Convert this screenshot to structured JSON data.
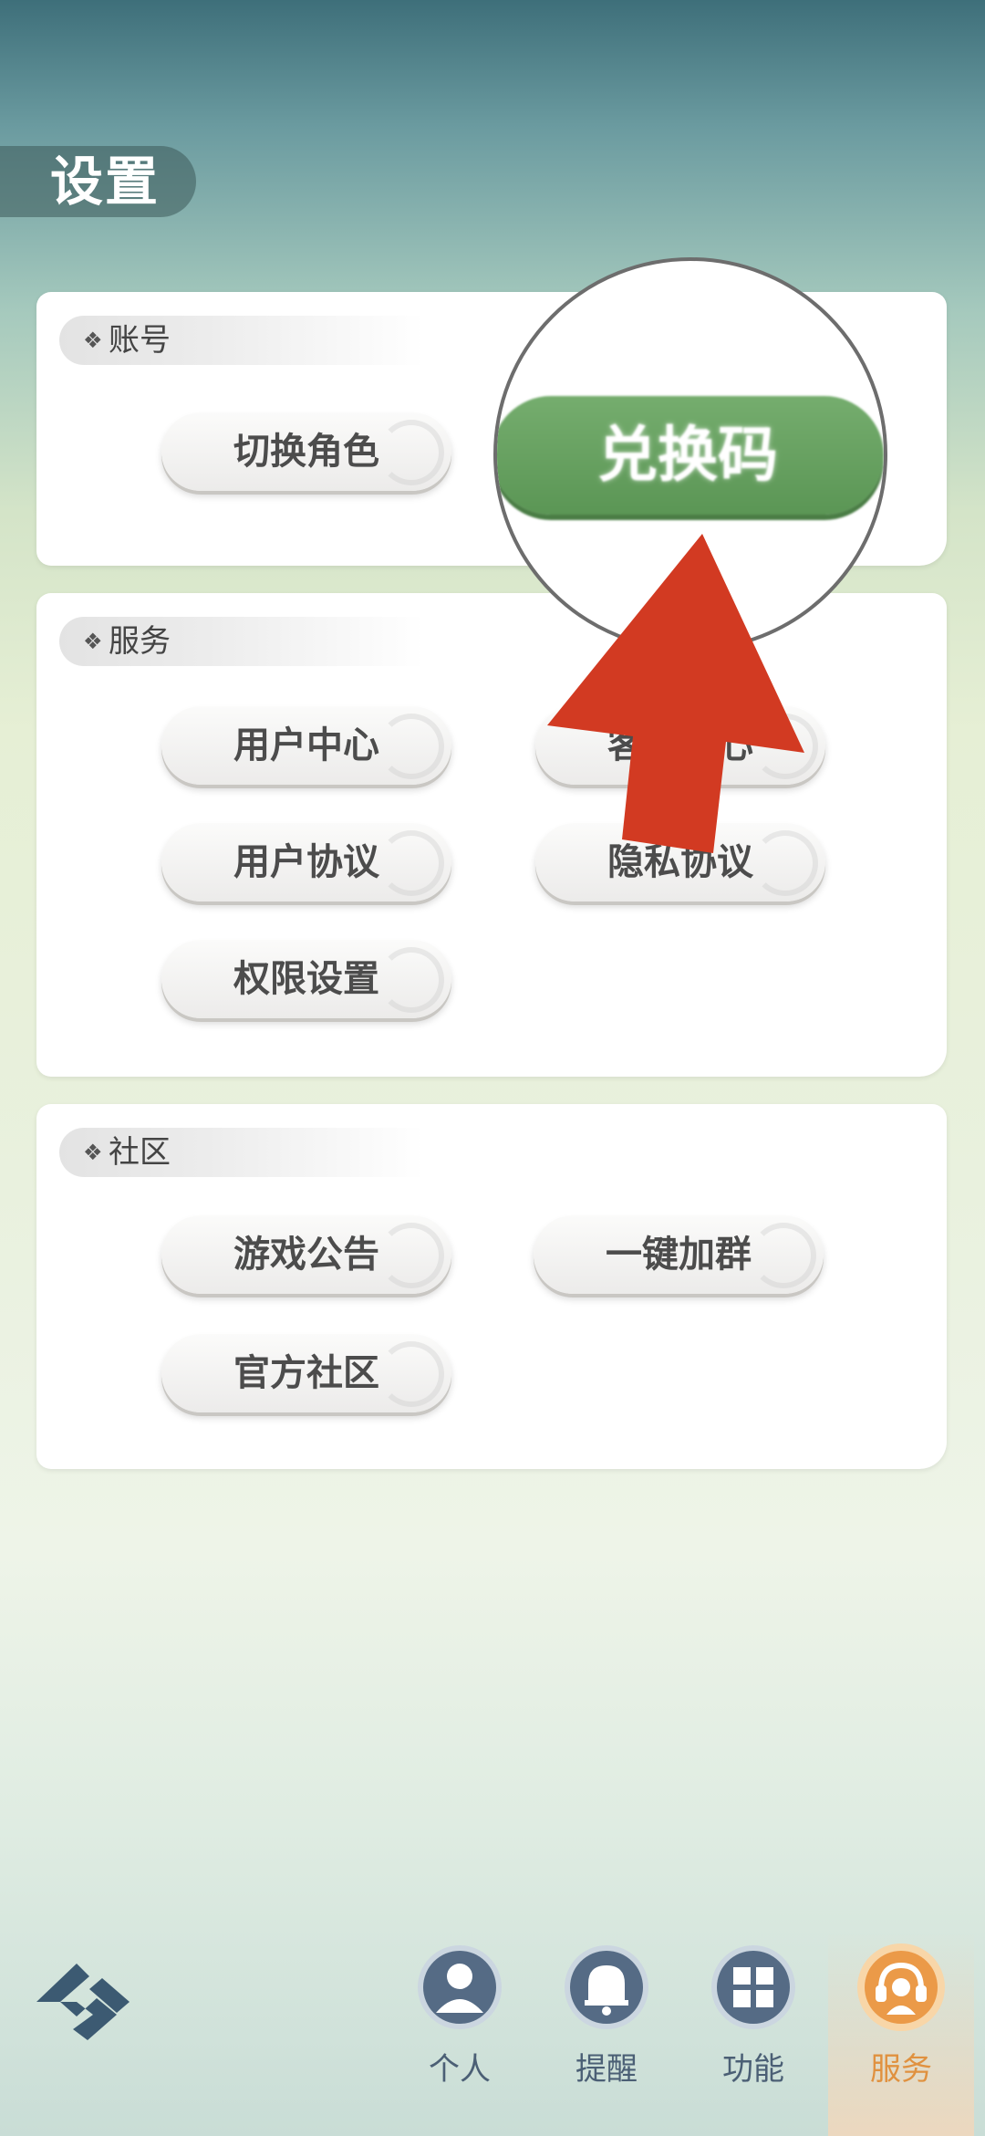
{
  "header": {
    "title": "设置"
  },
  "sections": {
    "account": {
      "title": "账号",
      "buttons": [
        "切换角色",
        "兑换码"
      ]
    },
    "service": {
      "title": "服务",
      "buttons": [
        "用户中心",
        "客服中心",
        "用户协议",
        "隐私协议",
        "权限设置"
      ]
    },
    "community": {
      "title": "社区",
      "buttons": [
        "游戏公告",
        "一键加群",
        "官方社区"
      ]
    }
  },
  "magnified_button": "兑换码",
  "bottom_nav": {
    "items": [
      {
        "label": "个人",
        "icon": "person-icon"
      },
      {
        "label": "提醒",
        "icon": "bell-icon"
      },
      {
        "label": "功能",
        "icon": "grid-icon"
      },
      {
        "label": "服务",
        "icon": "headset-icon"
      }
    ],
    "active": "服务"
  },
  "colors": {
    "accent_green": "#6aa463",
    "highlight_arrow": "#d23a22",
    "active_nav": "#e0913f",
    "nav_icon": "#4b5f75"
  }
}
